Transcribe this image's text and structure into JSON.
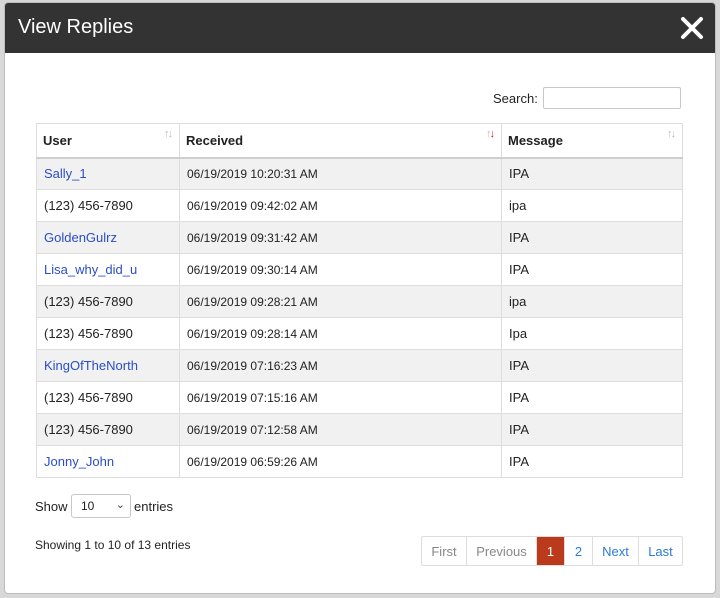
{
  "modal": {
    "title": "View Replies"
  },
  "search": {
    "label": "Search:",
    "value": ""
  },
  "table": {
    "headers": [
      "User",
      "Received",
      "Message"
    ],
    "rows": [
      {
        "user": "Sally_1",
        "link": true,
        "received": "06/19/2019 10:20:31 AM",
        "message": "IPA"
      },
      {
        "user": "(123) 456-7890",
        "link": false,
        "received": "06/19/2019 09:42:02 AM",
        "message": "ipa"
      },
      {
        "user": "GoldenGulrz",
        "link": true,
        "received": "06/19/2019 09:31:42 AM",
        "message": "IPA"
      },
      {
        "user": "Lisa_why_did_u",
        "link": true,
        "received": "06/19/2019 09:30:14 AM",
        "message": "IPA"
      },
      {
        "user": "(123) 456-7890",
        "link": false,
        "received": "06/19/2019 09:28:21 AM",
        "message": "ipa"
      },
      {
        "user": "(123) 456-7890",
        "link": false,
        "received": "06/19/2019 09:28:14 AM",
        "message": "Ipa"
      },
      {
        "user": "KingOfTheNorth",
        "link": true,
        "received": "06/19/2019 07:16:23 AM",
        "message": "IPA"
      },
      {
        "user": "(123) 456-7890",
        "link": false,
        "received": "06/19/2019 07:15:16 AM",
        "message": "IPA"
      },
      {
        "user": "(123) 456-7890",
        "link": false,
        "received": "06/19/2019 07:12:58 AM",
        "message": "IPA"
      },
      {
        "user": "Jonny_John",
        "link": true,
        "received": "06/19/2019 06:59:26 AM",
        "message": "IPA"
      }
    ]
  },
  "length": {
    "show_label": "Show",
    "selected": "10",
    "entries_label": "entries"
  },
  "info": "Showing 1 to 10 of 13 entries",
  "pagination": {
    "first": "First",
    "previous": "Previous",
    "pages": [
      "1",
      "2"
    ],
    "current": "1",
    "next": "Next",
    "last": "Last"
  },
  "colors": {
    "titlebar": "#333333",
    "link": "#2a4ec6",
    "active_page": "#bb3a1c",
    "sort_active": "#d52020"
  }
}
